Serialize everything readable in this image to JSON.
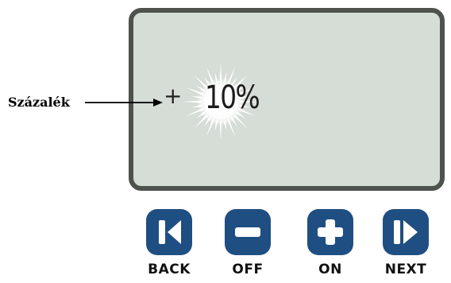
{
  "display": {
    "indicator_symbol": "+",
    "value": "10%"
  },
  "callout": {
    "label": "Százalék"
  },
  "buttons": [
    {
      "label": "BACK",
      "icon": "back-icon"
    },
    {
      "label": "OFF",
      "icon": "minus-icon"
    },
    {
      "label": "ON",
      "icon": "plus-icon"
    },
    {
      "label": "NEXT",
      "icon": "next-icon"
    }
  ],
  "colors": {
    "button_blue": "#1f4f82",
    "lcd_background": "#d6dcd6",
    "lcd_border": "#4d524d"
  }
}
